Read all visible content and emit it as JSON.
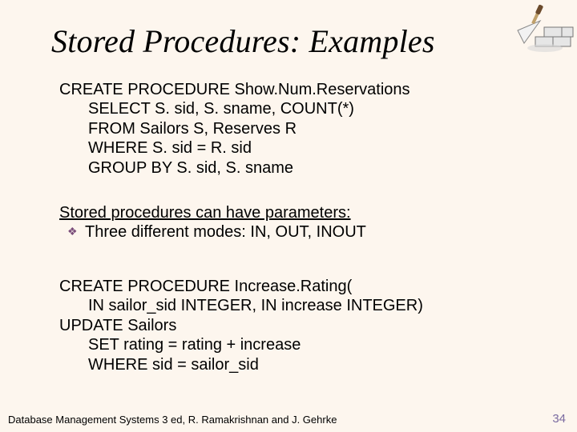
{
  "title": "Stored Procedures: Examples",
  "block1": {
    "l1": "CREATE PROCEDURE Show.Num.Reservations",
    "l2": "SELECT S. sid, S. sname, COUNT(*)",
    "l3": "FROM Sailors S, Reserves R",
    "l4": "WHERE S. sid = R. sid",
    "l5": "GROUP BY S. sid, S. sname"
  },
  "block2": {
    "heading": "Stored procedures can have parameters:",
    "bullet1": "Three different modes: IN, OUT, INOUT"
  },
  "block3": {
    "l1": "CREATE PROCEDURE Increase.Rating(",
    "l2": "IN sailor_sid INTEGER, IN increase INTEGER)",
    "l3": "UPDATE Sailors",
    "l4": "SET rating = rating + increase",
    "l5": "WHERE sid = sailor_sid"
  },
  "footer": "Database Management Systems 3 ed,  R. Ramakrishnan and J. Gehrke",
  "pagenum": "34",
  "icon": "trowel-bricks-icon"
}
